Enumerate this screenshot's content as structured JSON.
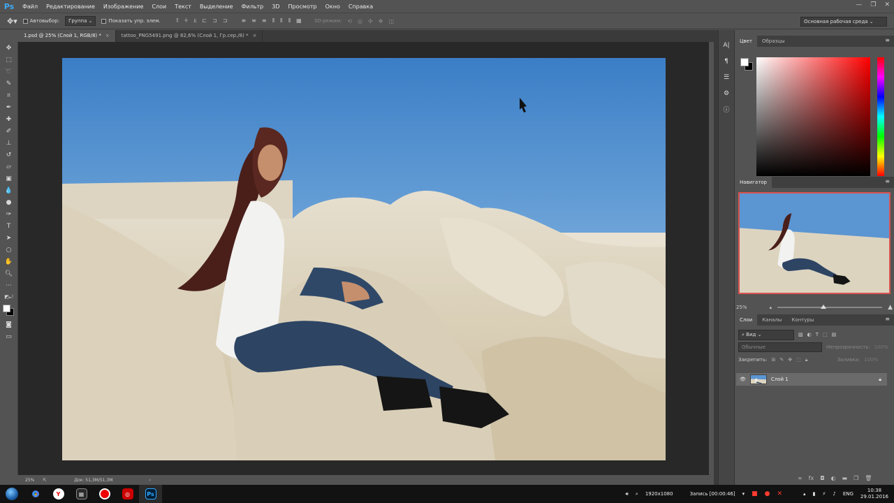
{
  "app": {
    "logo": "Ps"
  },
  "menu": [
    "Файл",
    "Редактирование",
    "Изображение",
    "Слои",
    "Текст",
    "Выделение",
    "Фильтр",
    "3D",
    "Просмотр",
    "Окно",
    "Справка"
  ],
  "options": {
    "autoselect_label": "Автовыбор:",
    "autoselect_value": "Группа",
    "show_transform_label": "Показать упр. элем.",
    "mode_3d_label": "3D-режим:",
    "workspace": "Основная рабочая среда"
  },
  "tabs": [
    {
      "label": "1.psd @ 25% (Слой 1, RGB/8) *",
      "close": "×"
    },
    {
      "label": "tattoo_PNG5491.png @ 82,6% (Слой 1, Гр.сер./8) *",
      "close": "×"
    }
  ],
  "status": {
    "zoom": "25%",
    "doc": "Док: 51,3M/51,3M",
    "arrow": "›"
  },
  "color_panel": {
    "tabs": [
      "Цвет",
      "Образцы"
    ],
    "fg": "#ffffff",
    "bg": "#000000"
  },
  "navigator": {
    "title": "Навигатор",
    "zoom": "25%",
    "zoom_fraction": 0.25
  },
  "layers_panel": {
    "tabs": [
      "Слои",
      "Каналы",
      "Контуры"
    ],
    "filter": "Вид",
    "blend_mode": "Обычные",
    "opacity_label": "Непрозрачность:",
    "opacity_value": "100%",
    "lock_label": "Закрепить:",
    "fill_label": "Заливка:",
    "fill_value": "100%",
    "layer_name": "Слой 1"
  },
  "taskbar": {
    "resolution": "1920x1080",
    "recording": "Запись [00:00:46]",
    "lang": "ENG",
    "time": "10:38",
    "date": "29.01.2016"
  },
  "icons": {
    "move": "move-icon",
    "marquee": "marquee-icon",
    "lasso": "lasso-icon",
    "brush": "brush-icon",
    "hand": "hand-icon",
    "zoom": "zoom-icon"
  }
}
